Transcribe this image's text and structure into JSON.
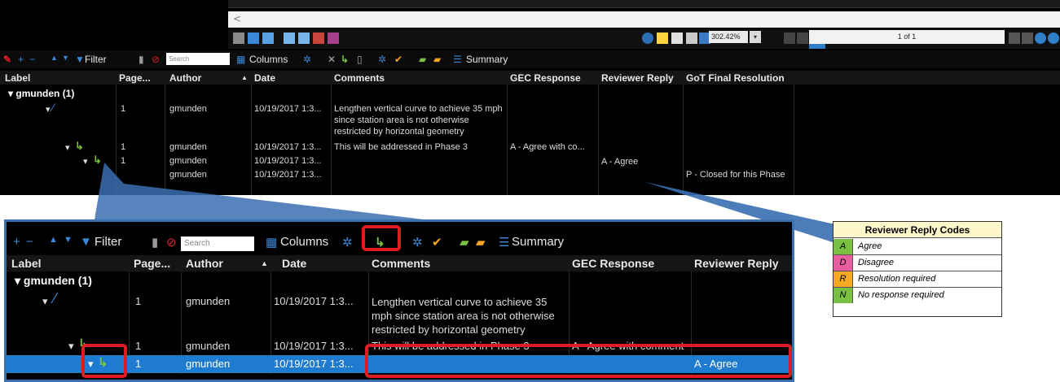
{
  "colors": {
    "accent_blue": "#2e75b6",
    "selection_blue": "#1f7bd0",
    "callout_blue": "#3a6fb0",
    "highlight_red": "#e11b22",
    "reply_green": "#7ac143"
  },
  "top_window": {
    "input_placeholder": "<",
    "zoom_value": "302.42%",
    "page_indicator": "1 of 1",
    "toolbar": {
      "filter": "Filter",
      "search_placeholder": "Search",
      "columns": "Columns",
      "summary": "Summary"
    },
    "headers": [
      "Label",
      "Page...",
      "Author",
      "Date",
      "Comments",
      "GEC Response",
      "Reviewer Reply",
      "GoT Final Resolution"
    ],
    "group_label": "gmunden (1)",
    "rows": [
      {
        "page": "1",
        "author": "gmunden",
        "date": "10/19/2017 1:3...",
        "comments": "Lengthen vertical curve to achieve 35 mph since station area is not otherwise restricted by horizontal geometry",
        "gec": "",
        "reply": "",
        "final": ""
      },
      {
        "page": "1",
        "author": "gmunden",
        "date": "10/19/2017 1:3...",
        "comments": "This will be addressed in Phase 3",
        "gec": "A - Agree with co...",
        "reply": "",
        "final": ""
      },
      {
        "page": "1",
        "author": "gmunden",
        "date": "10/19/2017 1:3...",
        "comments": "",
        "gec": "",
        "reply": "A - Agree",
        "final": ""
      },
      {
        "page": "",
        "author": "gmunden",
        "date": "10/19/2017 1:3...",
        "comments": "",
        "gec": "",
        "reply": "",
        "final": "P - Closed for this Phase"
      }
    ]
  },
  "zoom_panel": {
    "toolbar": {
      "filter": "Filter",
      "search_placeholder": "Search",
      "columns": "Columns",
      "summary": "Summary"
    },
    "headers": [
      "Label",
      "Page...",
      "Author",
      "Date",
      "Comments",
      "GEC Response",
      "Reviewer Reply"
    ],
    "group_label": "gmunden (1)",
    "rows": [
      {
        "page": "1",
        "author": "gmunden",
        "date": "10/19/2017 1:3...",
        "comments": "Lengthen vertical curve to achieve 35 mph since station area is not otherwise restricted by horizontal geometry",
        "gec": "",
        "reply": ""
      },
      {
        "page": "1",
        "author": "gmunden",
        "date": "10/19/2017 1:3...",
        "comments": "This will be addressed in Phase 3",
        "gec": "A - Agree with comment",
        "reply": ""
      },
      {
        "page": "1",
        "author": "gmunden",
        "date": "10/19/2017 1:3...",
        "comments": "",
        "gec": "",
        "reply": "A - Agree"
      }
    ]
  },
  "legend": {
    "title": "Reviewer Reply Codes",
    "items": [
      {
        "code": "A",
        "label": "Agree",
        "color": "#7ac143"
      },
      {
        "code": "D",
        "label": "Disagree",
        "color": "#e75fa0"
      },
      {
        "code": "R",
        "label": "Resolution required",
        "color": "#f7a823"
      },
      {
        "code": "N",
        "label": "No response required",
        "color": "#7ac143"
      }
    ]
  }
}
